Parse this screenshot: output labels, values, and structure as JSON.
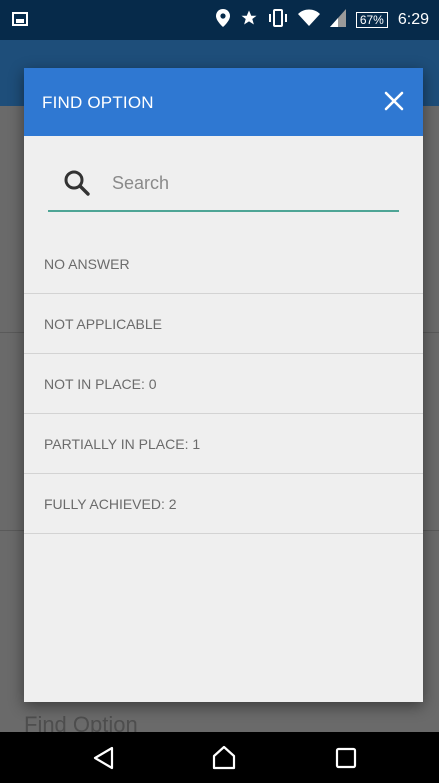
{
  "status_bar": {
    "battery": "67%",
    "time": "6:29",
    "icons": [
      "image-icon",
      "location-icon",
      "star-icon",
      "vibrate-icon",
      "wifi-icon",
      "signal-icon"
    ]
  },
  "background": {
    "footer_text": "Find Option"
  },
  "dialog": {
    "title": "FIND OPTION",
    "search": {
      "placeholder": "Search",
      "value": ""
    },
    "options": [
      "NO ANSWER",
      "NOT APPLICABLE",
      "NOT IN PLACE: 0",
      "PARTIALLY IN PLACE: 1",
      "FULLY ACHIEVED: 2"
    ]
  },
  "colors": {
    "header": "#2f78d2",
    "underline": "#4ea596",
    "dialog_bg": "#efefef"
  }
}
